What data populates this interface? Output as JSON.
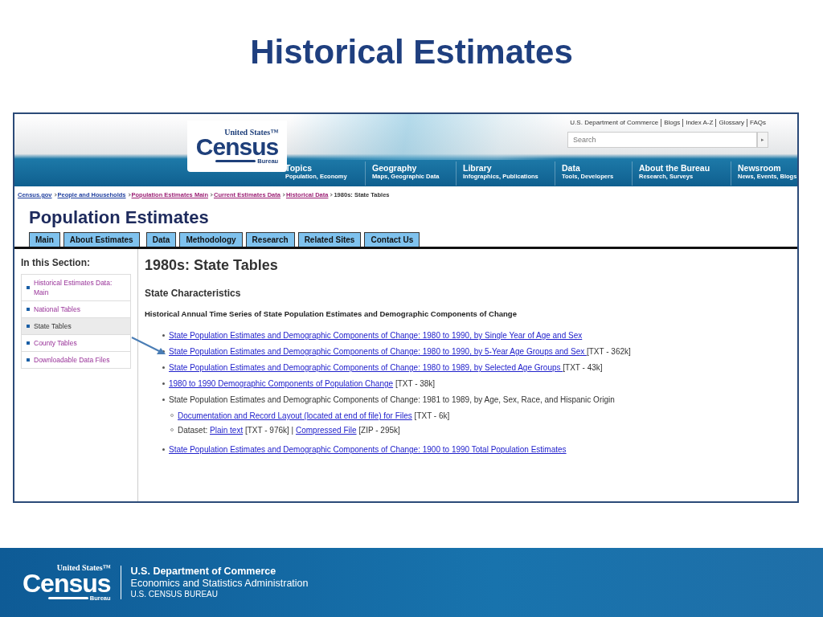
{
  "slide": {
    "title": "Historical Estimates"
  },
  "site_header": {
    "logo": {
      "top": "United States™",
      "main": "Census",
      "bottom": "Bureau"
    },
    "utility_links": [
      "U.S. Department of Commerce",
      "Blogs",
      "Index A-Z",
      "Glossary",
      "FAQs"
    ],
    "search": {
      "placeholder": "Search",
      "button": "▸"
    },
    "nav": [
      {
        "title": "Topics",
        "subtitle": "Population, Economy"
      },
      {
        "title": "Geography",
        "subtitle": "Maps, Geographic Data"
      },
      {
        "title": "Library",
        "subtitle": "Infographics, Publications"
      },
      {
        "title": "Data",
        "subtitle": "Tools, Developers"
      },
      {
        "title": "About the Bureau",
        "subtitle": "Research, Surveys"
      },
      {
        "title": "Newsroom",
        "subtitle": "News, Events, Blogs"
      }
    ]
  },
  "breadcrumb": [
    {
      "label": "Census.gov",
      "kind": "link"
    },
    {
      "label": "People and Households",
      "kind": "link"
    },
    {
      "label": "Population Estimates Main",
      "kind": "visited"
    },
    {
      "label": "Current Estimates Data",
      "kind": "visited"
    },
    {
      "label": "Historical Data",
      "kind": "visited"
    },
    {
      "label": "1980s: State Tables",
      "kind": "current"
    }
  ],
  "page_title": "Population Estimates",
  "tabs": [
    {
      "label": "Main"
    },
    {
      "label": "About Estimates"
    },
    {
      "label": "Data"
    },
    {
      "label": "Methodology"
    },
    {
      "label": "Research"
    },
    {
      "label": "Related Sites"
    },
    {
      "label": "Contact Us"
    }
  ],
  "sidebar": {
    "heading": "In this Section:",
    "items": [
      {
        "label": "Historical Estimates Data: Main",
        "selected": false
      },
      {
        "label": "National Tables",
        "selected": false
      },
      {
        "label": "State Tables",
        "selected": true
      },
      {
        "label": "County Tables",
        "selected": false
      },
      {
        "label": "Downloadable Data Files",
        "selected": false
      }
    ]
  },
  "content": {
    "heading": "1980s: State Tables",
    "subheading": "State Characteristics",
    "section_title": "Historical Annual Time Series of State Population Estimates and Demographic Components of Change",
    "items": [
      {
        "parts": [
          {
            "kind": "link",
            "text": "State Population Estimates and Demographic Components of Change: 1980 to 1990, by Single Year of Age and Sex"
          }
        ]
      },
      {
        "parts": [
          {
            "kind": "link",
            "text": "State Population Estimates and Demographic Components of Change: 1980 to 1990, by 5-Year Age Groups and Sex "
          },
          {
            "kind": "text",
            "text": "[TXT - 362k]"
          }
        ]
      },
      {
        "parts": [
          {
            "kind": "link",
            "text": "State Population Estimates and Demographic Components of Change: 1980 to 1989, by Selected Age Groups "
          },
          {
            "kind": "text",
            "text": "[TXT - 43k]"
          }
        ]
      },
      {
        "parts": [
          {
            "kind": "link",
            "text": "1980 to 1990 Demographic Components of Population Change"
          },
          {
            "kind": "text",
            "text": "[TXT - 38k]"
          }
        ]
      },
      {
        "parts": [
          {
            "kind": "text",
            "text": "State Population Estimates and Demographic Components of Change: 1981 to 1989, by Age, Sex, Race, and Hispanic Origin"
          }
        ],
        "children": [
          {
            "parts": [
              {
                "kind": "link",
                "text": "Documentation and Record Layout (located at end of file) for Files"
              },
              {
                "kind": "text",
                "text": "[TXT - 6k]"
              }
            ]
          },
          {
            "parts": [
              {
                "kind": "text",
                "text": "Dataset:"
              },
              {
                "kind": "link",
                "text": "Plain text"
              },
              {
                "kind": "text",
                "text": "[TXT - 976k] |"
              },
              {
                "kind": "link",
                "text": "Compressed File"
              },
              {
                "kind": "text",
                "text": "[ZIP - 295k]"
              }
            ]
          }
        ]
      },
      {
        "parts": [
          {
            "kind": "link",
            "text": "State Population Estimates and Demographic Components of Change: 1900 to 1990 Total Population Estimates"
          }
        ]
      }
    ]
  },
  "footer": {
    "logo": {
      "top": "United States™",
      "main": "Census",
      "bottom": "Bureau"
    },
    "lines": [
      "U.S. Department of Commerce",
      "Economics and Statistics Administration",
      "U.S. CENSUS BUREAU"
    ]
  }
}
